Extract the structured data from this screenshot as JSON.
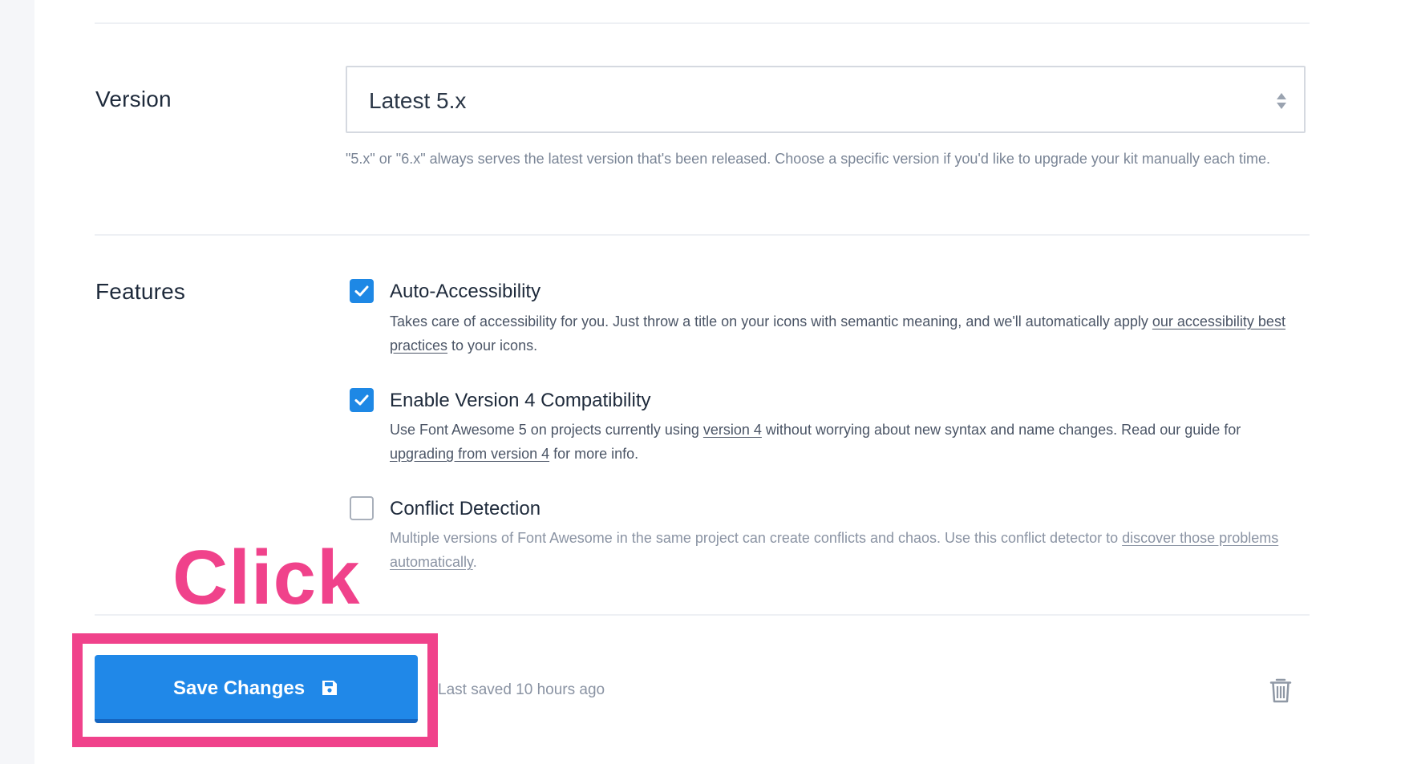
{
  "version": {
    "label": "Version",
    "selected": "Latest 5.x",
    "help": "\"5.x\" or \"6.x\" always serves the latest version that's been released. Choose a specific version if you'd like to upgrade your kit manually each time."
  },
  "features": {
    "label": "Features",
    "auto_accessibility": {
      "title": "Auto-Accessibility",
      "checked": true,
      "desc_pre": "Takes care of accessibility for you. Just throw a title on your icons with semantic meaning, and we'll automatically apply ",
      "desc_link": "our accessibility best practices",
      "desc_post": " to your icons."
    },
    "v4_compat": {
      "title": "Enable Version 4 Compatibility",
      "checked": true,
      "desc_pre": "Use Font Awesome 5 on projects currently using ",
      "desc_link1": "version 4",
      "desc_mid": " without worrying about new syntax and name changes. Read our guide for ",
      "desc_link2": "upgrading from version 4",
      "desc_post": " for more info."
    },
    "conflict_detection": {
      "title": "Conflict Detection",
      "checked": false,
      "desc_pre": "Multiple versions of Font Awesome in the same project can create conflicts and chaos. Use this conflict detector to ",
      "desc_link": "discover those problems automatically",
      "desc_post": "."
    }
  },
  "footer": {
    "save_label": "Save Changes",
    "last_saved": "Last saved 10 hours ago"
  },
  "annotation": {
    "text": "Click",
    "color": "#f0428b"
  },
  "colors": {
    "primary": "#2088e8",
    "checkbox": "#1e88e5"
  }
}
